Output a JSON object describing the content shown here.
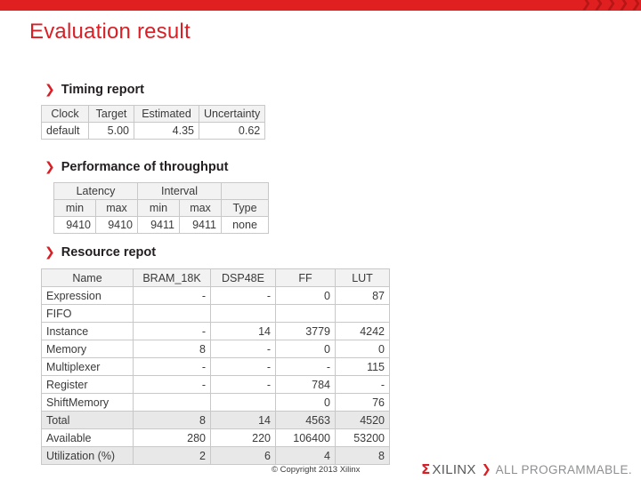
{
  "slide": {
    "title": "Evaluation result",
    "top_bar_color": "#e02020",
    "accent_color": "#d81f26"
  },
  "bullets": [
    {
      "marker": "❯",
      "label": "Timing report"
    },
    {
      "marker": "❯",
      "label": "Performance of throughput"
    },
    {
      "marker": "❯",
      "label": "Resource repot"
    }
  ],
  "timing_table": {
    "headers": [
      "Clock",
      "Target",
      "Estimated",
      "Uncertainty"
    ],
    "rows": [
      [
        "default",
        "5.00",
        "4.35",
        "0.62"
      ]
    ]
  },
  "performance_table": {
    "group_headers": [
      "Latency",
      "Interval",
      ""
    ],
    "sub_headers": [
      "min",
      "max",
      "min",
      "max",
      "Type"
    ],
    "rows": [
      [
        "9410",
        "9410",
        "9411",
        "9411",
        "none"
      ]
    ]
  },
  "resource_table": {
    "headers": [
      "Name",
      "BRAM_18K",
      "DSP48E",
      "FF",
      "LUT"
    ],
    "rows": [
      [
        "Expression",
        "-",
        "-",
        "0",
        "87"
      ],
      [
        "FIFO",
        "",
        "",
        "",
        ""
      ],
      [
        "Instance",
        "-",
        "14",
        "3779",
        "4242"
      ],
      [
        "Memory",
        "8",
        "-",
        "0",
        "0"
      ],
      [
        "Multiplexer",
        "-",
        "-",
        "-",
        "115"
      ],
      [
        "Register",
        "-",
        "-",
        "784",
        "-"
      ],
      [
        "ShiftMemory",
        "",
        "",
        "0",
        "76"
      ],
      [
        "Total",
        "8",
        "14",
        "4563",
        "4520"
      ],
      [
        "Available",
        "280",
        "220",
        "106400",
        "53200"
      ],
      [
        "Utilization (%)",
        "2",
        "6",
        "4",
        "8"
      ]
    ],
    "shaded_rows": [
      "Total",
      "Utilization (%)"
    ]
  },
  "footer": {
    "copyright": "© Copyright 2013 Xilinx",
    "logo_mark": "Σ",
    "logo_text": "XILINX",
    "logo_chevron": "❯",
    "logo_tagline": "ALL PROGRAMMABLE."
  }
}
